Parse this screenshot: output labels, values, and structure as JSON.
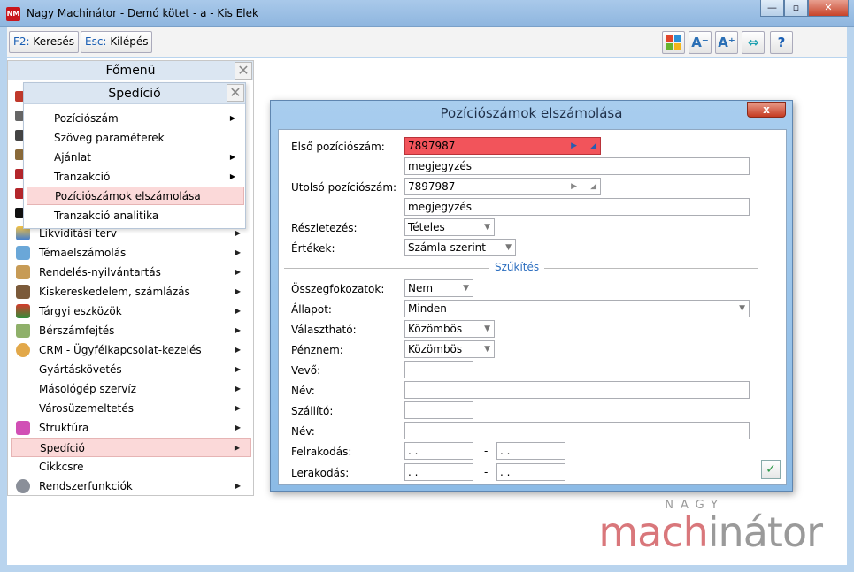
{
  "window": {
    "title": "Nagy Machinátor - Demó kötet - a - Kis Elek",
    "icon": "app-logo-icon",
    "buttons": [
      "minimize",
      "maximize",
      "close"
    ]
  },
  "toolbar": {
    "search_key": "F2:",
    "search_label": "Keresés",
    "exit_key": "Esc:",
    "exit_label": "Kilépés",
    "icons": [
      "grid-icon",
      "font-decrease-icon",
      "font-increase-icon",
      "arrows-icon",
      "help-icon"
    ],
    "font_decrease_text": "A",
    "font_increase_text": "A",
    "help_text": "?"
  },
  "main_menu": {
    "title": "Főmenü",
    "items": [
      {
        "label": "Likviditási terv",
        "icon": "chart-icon",
        "arrow": true
      },
      {
        "label": "Témaelszámolás",
        "icon": "calculator-icon",
        "arrow": true
      },
      {
        "label": "Rendelés-nyilvántartás",
        "icon": "package-icon",
        "arrow": true
      },
      {
        "label": "Kiskereskedelem, számlázás",
        "icon": "register-icon",
        "arrow": true
      },
      {
        "label": "Tárgyi eszközök",
        "icon": "house-icon",
        "arrow": true
      },
      {
        "label": "Bérszámfejtés",
        "icon": "money-icon",
        "arrow": true
      },
      {
        "label": "CRM - Ügyfélkapcsolat-kezelés",
        "icon": "people-icon",
        "arrow": true
      },
      {
        "label": "Gyártáskövetés",
        "icon": "",
        "arrow": true
      },
      {
        "label": "Másológép szervíz",
        "icon": "",
        "arrow": true
      },
      {
        "label": "Városüzemeltetés",
        "icon": "",
        "arrow": true
      },
      {
        "label": "Struktúra",
        "icon": "cube-icon",
        "arrow": true
      },
      {
        "label": "Spedíció",
        "icon": "",
        "arrow": true,
        "active": true
      },
      {
        "label": "Cikkcsre",
        "icon": "",
        "arrow": false
      },
      {
        "label": "Rendszerfunkciók",
        "icon": "gears-icon",
        "arrow": true
      }
    ]
  },
  "sub_menu": {
    "title": "Spedíció",
    "items": [
      {
        "label": "Pozíciószám",
        "arrow": true
      },
      {
        "label": "Szöveg paraméterek",
        "arrow": false
      },
      {
        "label": "Ajánlat",
        "arrow": true
      },
      {
        "label": "Tranzakció",
        "arrow": true
      },
      {
        "label": "Pozíciószámok elszámolása",
        "arrow": false,
        "active": true
      },
      {
        "label": "Tranzakció analitika",
        "arrow": false
      }
    ]
  },
  "dialog": {
    "title": "Pozíciószámok elszámolása",
    "close": "x",
    "first_label": "Első pozíciószám:",
    "first_value": "7897987",
    "first_note": "megjegyzés",
    "last_label": "Utolsó pozíciószám:",
    "last_value": "7897987",
    "last_note": "megjegyzés",
    "detail_label": "Részletezés:",
    "detail_value": "Tételes",
    "values_label": "Értékek:",
    "values_value": "Számla szerint",
    "section": "Szűkítés",
    "subtotal_label": "Összegfokozatok:",
    "subtotal_value": "Nem",
    "status_label": "Állapot:",
    "status_value": "Minden",
    "selectable_label": "Választható:",
    "selectable_value": "Közömbös",
    "currency_label": "Pénznem:",
    "currency_value": "Közömbös",
    "buyer_label": "Vevő:",
    "buyer_value": "",
    "name1_label": "Név:",
    "name1_value": "",
    "carrier_label": "Szállító:",
    "carrier_value": "",
    "name2_label": "Név:",
    "name2_value": "",
    "loading_label": "Felrakodás:",
    "loading_from": " .  .",
    "loading_to": " .  .",
    "unloading_label": "Lerakodás:",
    "unloading_from": " .  .",
    "unloading_to": " .  .",
    "dash": "-",
    "ok_icon": "checkmark-icon",
    "ok_symbol": "✓"
  },
  "watermark": {
    "top": "NAGY",
    "part1": "mach",
    "part2": "inátor"
  },
  "colors": {
    "highlight_field": "#f2545b",
    "active_menu": "#fbd9d9",
    "accent_blue": "#2d6fc0"
  }
}
